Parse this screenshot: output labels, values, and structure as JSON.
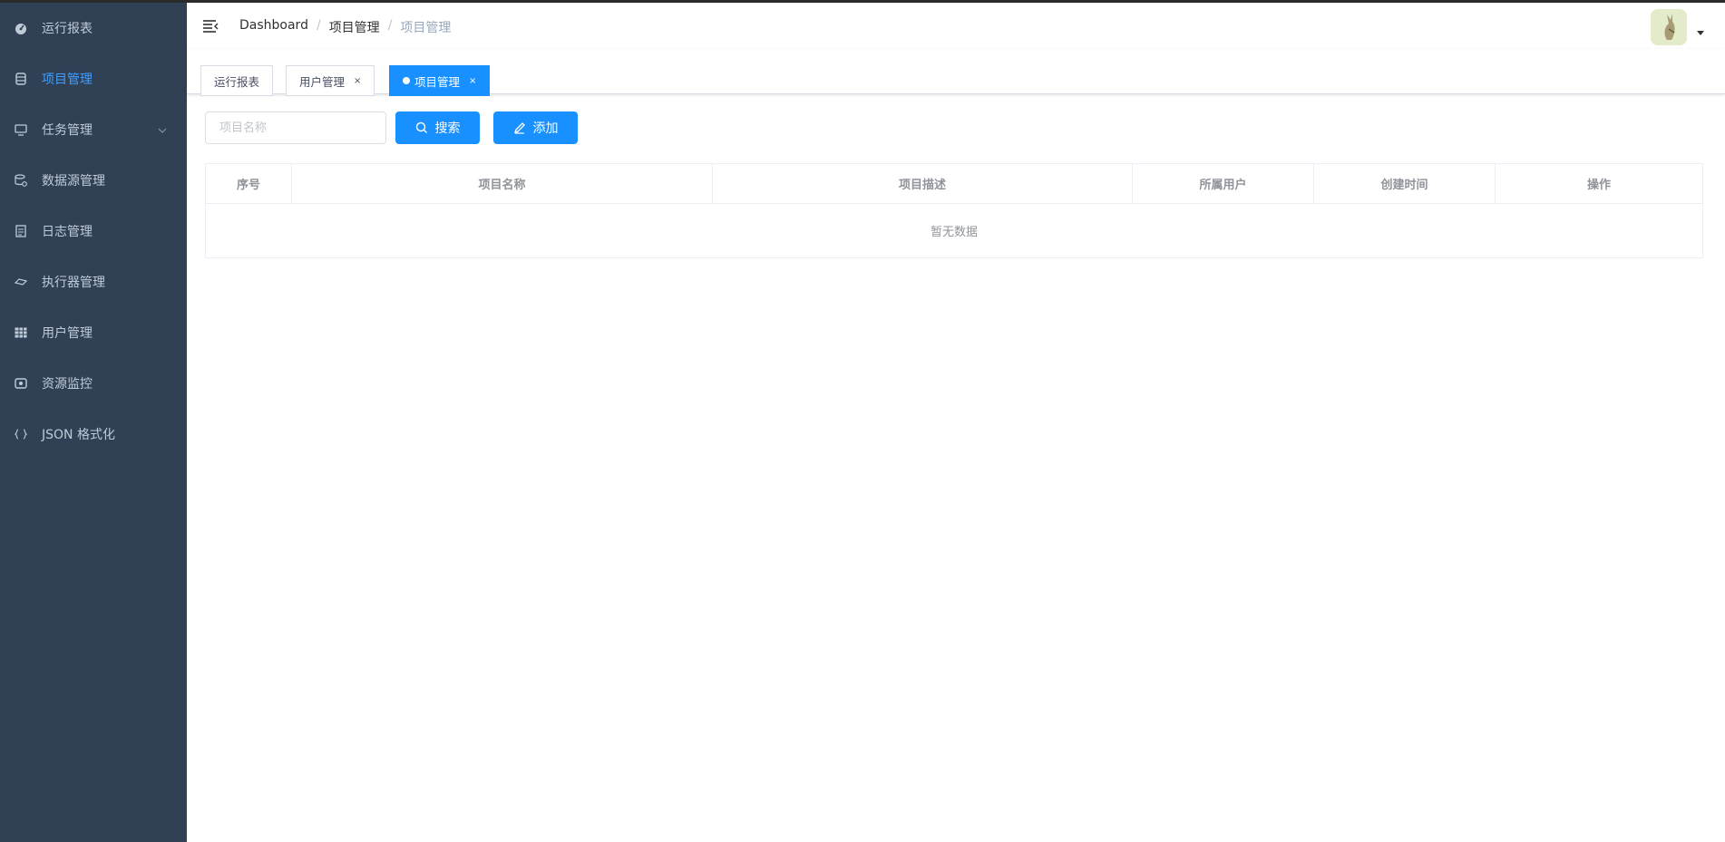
{
  "sidebar": {
    "items": [
      {
        "label": "运行报表",
        "icon": "dashboard-icon"
      },
      {
        "label": "项目管理",
        "icon": "database-icon"
      },
      {
        "label": "任务管理",
        "icon": "monitor-icon"
      },
      {
        "label": "数据源管理",
        "icon": "datasource-icon"
      },
      {
        "label": "日志管理",
        "icon": "document-icon"
      },
      {
        "label": "执行器管理",
        "icon": "executor-icon"
      },
      {
        "label": "用户管理",
        "icon": "table-icon"
      },
      {
        "label": "资源监控",
        "icon": "monitor-resource-icon"
      },
      {
        "label": "JSON 格式化",
        "icon": "braces-icon"
      }
    ],
    "active_index": 1
  },
  "navbar": {
    "breadcrumb": [
      "Dashboard",
      "项目管理",
      "项目管理"
    ],
    "separator": "/"
  },
  "tags": [
    {
      "label": "运行报表"
    },
    {
      "label": "用户管理",
      "close": "×"
    },
    {
      "label": "项目管理",
      "close": "×"
    }
  ],
  "toolbar": {
    "search_placeholder": "项目名称",
    "search_label": "搜索",
    "add_label": "添加"
  },
  "table": {
    "columns": [
      "序号",
      "项目名称",
      "项目描述",
      "所属用户",
      "创建时间",
      "操作"
    ],
    "empty_text": "暂无数据"
  },
  "colors": {
    "sidebar_bg": "#304156",
    "sidebar_text": "#bfcbd9",
    "accent": "#1890ff"
  }
}
